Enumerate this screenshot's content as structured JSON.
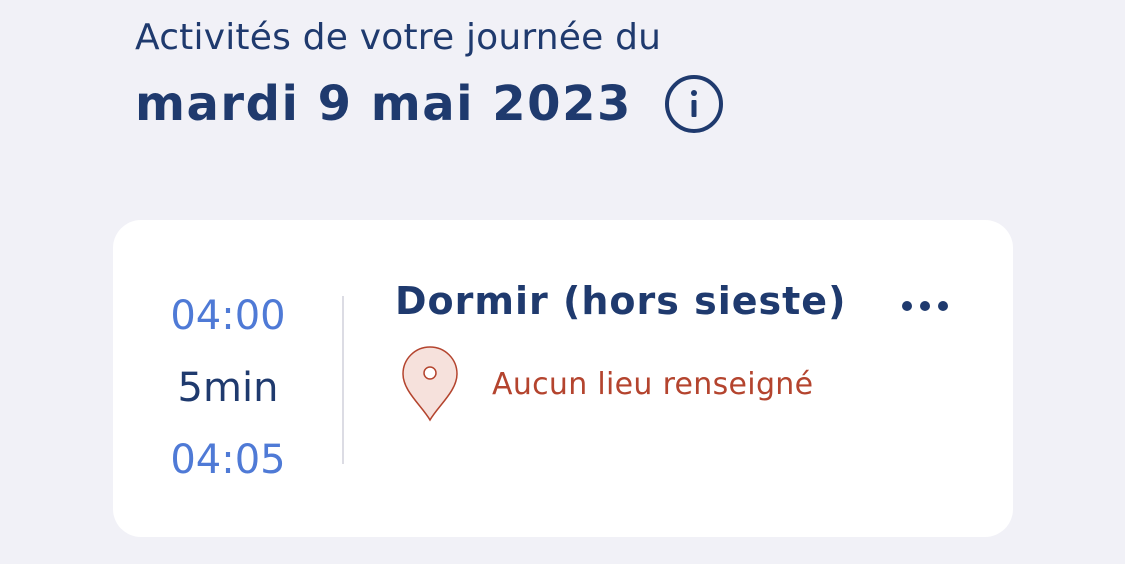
{
  "header": {
    "subtitle": "Activités de votre journée du",
    "date": "mardi 9 mai 2023",
    "info_icon": "info-icon"
  },
  "activity": {
    "start_time": "04:00",
    "duration": "5min",
    "end_time": "04:05",
    "title": "Dormir (hors sieste)",
    "location": "Aucun lieu renseigné",
    "location_icon": "map-pin-icon",
    "more_icon": "more-horizontal-icon"
  },
  "colors": {
    "background": "#f1f1f7",
    "primary": "#1f3a6e",
    "time_blue": "#4f7ad6",
    "location_red": "#b4442e",
    "pin_fill": "#f6e1dc"
  }
}
